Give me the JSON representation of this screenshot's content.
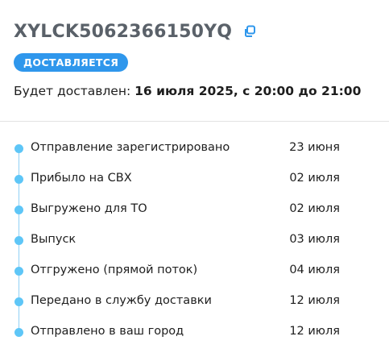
{
  "shipment": {
    "track_number": "XYLCK5062366150YQ",
    "status_badge": "ДОСТАВЛЯЕТСЯ",
    "eta_label": "Будет доставлен: ",
    "eta_value": "16 июля 2025, с 20:00 до 21:00"
  },
  "colors": {
    "badge_bg": "#2f97ec",
    "timeline_dot": "#5ec6f7",
    "timeline_line": "#8fd0f5",
    "copy_icon": "#2f97ec"
  },
  "icons": {
    "copy": "copy-icon"
  },
  "events": [
    {
      "title": "Отправление зарегистрировано",
      "date": "23 июня"
    },
    {
      "title": "Прибыло на СВХ",
      "date": "02 июля"
    },
    {
      "title": "Выгружено для ТО",
      "date": "02 июля"
    },
    {
      "title": "Выпуск",
      "date": "03 июля"
    },
    {
      "title": "Отгружено (прямой поток)",
      "date": "04 июля"
    },
    {
      "title": "Передано в службу доставки",
      "date": "12 июля"
    },
    {
      "title": "Отправлено в ваш город",
      "date": "12 июля"
    }
  ]
}
